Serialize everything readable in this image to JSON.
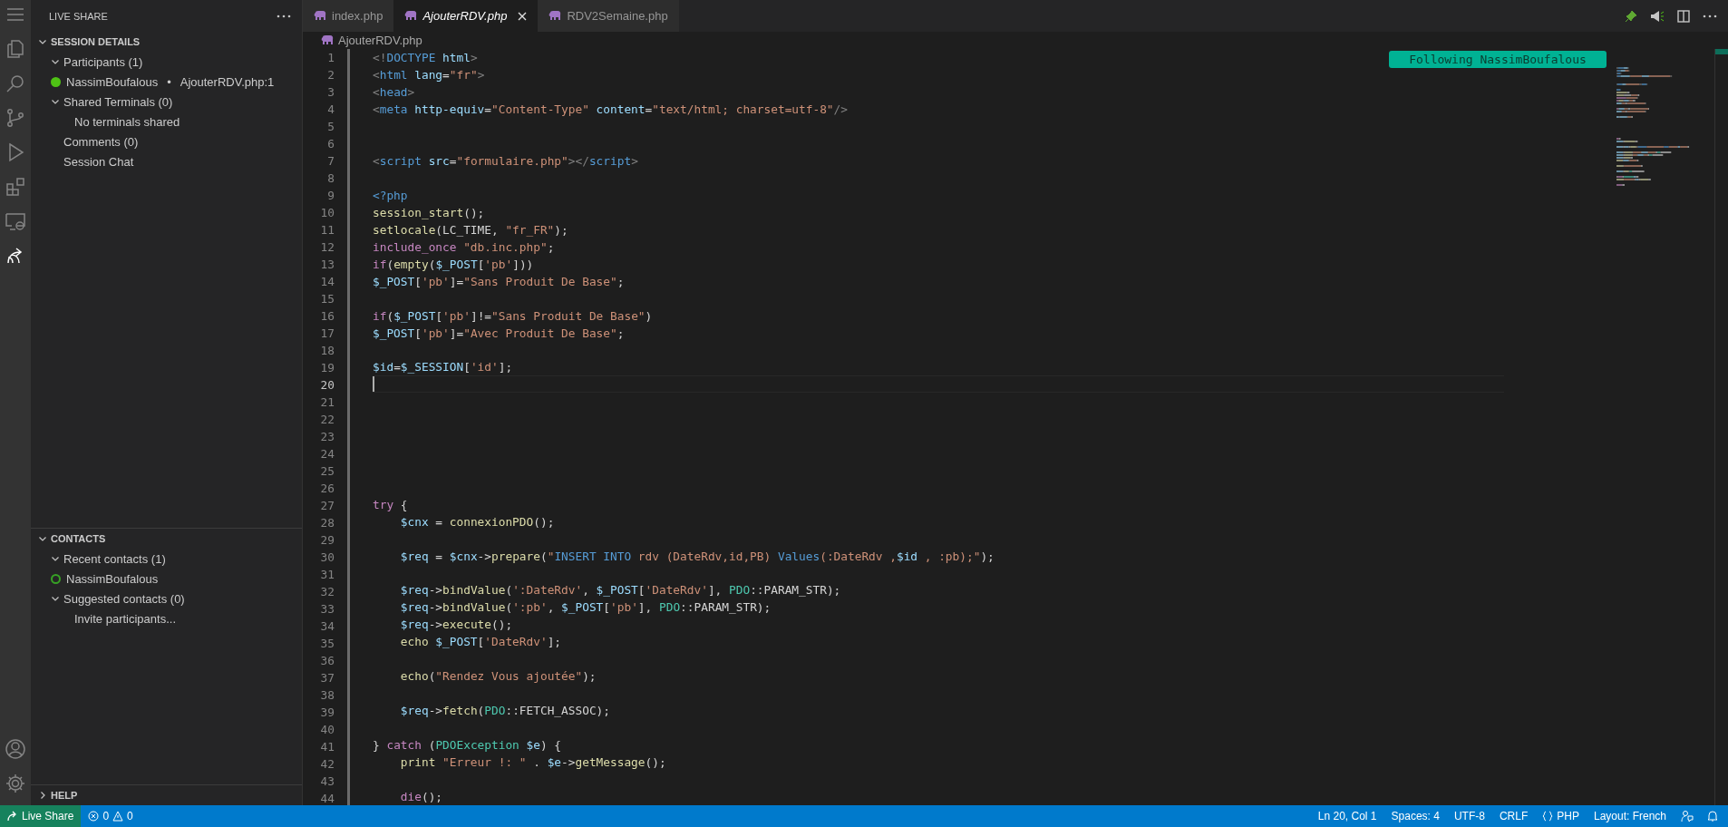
{
  "sidebar": {
    "title": "LIVE SHARE",
    "sections": [
      {
        "title": "SESSION DETAILS",
        "expanded": true,
        "items": [
          {
            "kind": "group",
            "label": "Participants (1)",
            "expanded": true,
            "children": [
              {
                "kind": "participant",
                "label": "NassimBoufalous",
                "separator": "•",
                "detail": "AjouterRDV.php:1"
              }
            ]
          },
          {
            "kind": "group",
            "label": "Shared Terminals (0)",
            "expanded": true,
            "children": [
              {
                "kind": "leaf",
                "label": "No terminals shared"
              }
            ]
          },
          {
            "kind": "leaf",
            "label": "Comments (0)"
          },
          {
            "kind": "leaf",
            "label": "Session Chat"
          }
        ]
      },
      {
        "title": "CONTACTS",
        "expanded": true,
        "items": [
          {
            "kind": "group",
            "label": "Recent contacts (1)",
            "expanded": true,
            "children": [
              {
                "kind": "contact",
                "label": "NassimBoufalous"
              }
            ]
          },
          {
            "kind": "group",
            "label": "Suggested contacts (0)",
            "expanded": true,
            "children": [
              {
                "kind": "leaf",
                "label": "Invite participants..."
              }
            ]
          }
        ]
      },
      {
        "title": "HELP",
        "expanded": false
      }
    ]
  },
  "tabs": [
    {
      "label": "index.php",
      "selected": false
    },
    {
      "label": "AjouterRDV.php",
      "selected": true
    },
    {
      "label": "RDV2Semaine.php",
      "selected": false
    }
  ],
  "breadcrumb": "AjouterRDV.php",
  "following_badge": "Following NassimBoufalous",
  "code_lines": [
    {
      "number": "1",
      "current": false,
      "tokens": [
        {
          "kind": "tag",
          "text": "<!"
        },
        {
          "kind": "tagname",
          "text": "DOCTYPE"
        },
        {
          "kind": "attr",
          "text": " html"
        },
        {
          "kind": "tag",
          "text": ">"
        }
      ]
    },
    {
      "number": "2",
      "current": false,
      "tokens": [
        {
          "kind": "tag",
          "text": "<"
        },
        {
          "kind": "tagname",
          "text": "html"
        },
        {
          "kind": "attr",
          "text": " lang"
        },
        {
          "kind": "plain",
          "text": "="
        },
        {
          "kind": "str",
          "text": "\"fr\""
        },
        {
          "kind": "tag",
          "text": ">"
        }
      ]
    },
    {
      "number": "3",
      "current": false,
      "tokens": [
        {
          "kind": "tag",
          "text": "<"
        },
        {
          "kind": "tagname",
          "text": "head"
        },
        {
          "kind": "tag",
          "text": ">"
        }
      ]
    },
    {
      "number": "4",
      "current": false,
      "tokens": [
        {
          "kind": "tag",
          "text": "<"
        },
        {
          "kind": "tagname",
          "text": "meta"
        },
        {
          "kind": "attr",
          "text": " http-equiv"
        },
        {
          "kind": "plain",
          "text": "="
        },
        {
          "kind": "str",
          "text": "\"Content-Type\""
        },
        {
          "kind": "attr",
          "text": " content"
        },
        {
          "kind": "plain",
          "text": "="
        },
        {
          "kind": "str",
          "text": "\"text/html; charset=utf-8\""
        },
        {
          "kind": "tag",
          "text": "/>"
        }
      ]
    },
    {
      "number": "5",
      "current": false
    },
    {
      "number": "6",
      "current": false
    },
    {
      "number": "7",
      "current": false,
      "tokens": [
        {
          "kind": "tag",
          "text": "<"
        },
        {
          "kind": "tagname",
          "text": "script"
        },
        {
          "kind": "attr",
          "text": " src"
        },
        {
          "kind": "plain",
          "text": "="
        },
        {
          "kind": "str",
          "text": "\"formulaire.php\""
        },
        {
          "kind": "tag",
          "text": "></"
        },
        {
          "kind": "tagname",
          "text": "script"
        },
        {
          "kind": "tag",
          "text": ">"
        }
      ]
    },
    {
      "number": "8",
      "current": false
    },
    {
      "number": "9",
      "current": false,
      "tokens": [
        {
          "kind": "tagname",
          "text": "<?php"
        }
      ]
    },
    {
      "number": "10",
      "current": false,
      "tokens": [
        {
          "kind": "fn",
          "text": "session_start"
        },
        {
          "kind": "plain",
          "text": "();"
        }
      ]
    },
    {
      "number": "11",
      "current": false,
      "tokens": [
        {
          "kind": "fn",
          "text": "setlocale"
        },
        {
          "kind": "plain",
          "text": "(LC_TIME,"
        },
        {
          "kind": "str",
          "text": " \"fr_FR\""
        },
        {
          "kind": "plain",
          "text": ");"
        }
      ]
    },
    {
      "number": "12",
      "current": false,
      "tokens": [
        {
          "kind": "kw",
          "text": "include_once"
        },
        {
          "kind": "str",
          "text": " \"db.inc.php\""
        },
        {
          "kind": "plain",
          "text": ";"
        }
      ]
    },
    {
      "number": "13",
      "current": false,
      "tokens": [
        {
          "kind": "kw",
          "text": "if"
        },
        {
          "kind": "plain",
          "text": "("
        },
        {
          "kind": "fn",
          "text": "empty"
        },
        {
          "kind": "plain",
          "text": "("
        },
        {
          "kind": "var",
          "text": "$_POST"
        },
        {
          "kind": "plain",
          "text": "["
        },
        {
          "kind": "str",
          "text": "'pb'"
        },
        {
          "kind": "plain",
          "text": "]))"
        }
      ]
    },
    {
      "number": "14",
      "current": false,
      "tokens": [
        {
          "kind": "var",
          "text": "$_POST"
        },
        {
          "kind": "plain",
          "text": "["
        },
        {
          "kind": "str",
          "text": "'pb'"
        },
        {
          "kind": "plain",
          "text": "]="
        },
        {
          "kind": "str",
          "text": "\"Sans Produit De Base\""
        },
        {
          "kind": "plain",
          "text": ";"
        }
      ]
    },
    {
      "number": "15",
      "current": false
    },
    {
      "number": "16",
      "current": false,
      "tokens": [
        {
          "kind": "kw",
          "text": "if"
        },
        {
          "kind": "plain",
          "text": "("
        },
        {
          "kind": "var",
          "text": "$_POST"
        },
        {
          "kind": "plain",
          "text": "["
        },
        {
          "kind": "str",
          "text": "'pb'"
        },
        {
          "kind": "plain",
          "text": "]!="
        },
        {
          "kind": "str",
          "text": "\"Sans Produit De Base\""
        },
        {
          "kind": "plain",
          "text": ")"
        }
      ]
    },
    {
      "number": "17",
      "current": false,
      "tokens": [
        {
          "kind": "var",
          "text": "$_POST"
        },
        {
          "kind": "plain",
          "text": "["
        },
        {
          "kind": "str",
          "text": "'pb'"
        },
        {
          "kind": "plain",
          "text": "]="
        },
        {
          "kind": "str",
          "text": "\"Avec Produit De Base\""
        },
        {
          "kind": "plain",
          "text": ";"
        }
      ]
    },
    {
      "number": "18",
      "current": false
    },
    {
      "number": "19",
      "current": false,
      "tokens": [
        {
          "kind": "var",
          "text": "$id"
        },
        {
          "kind": "plain",
          "text": "="
        },
        {
          "kind": "var",
          "text": "$_SESSION"
        },
        {
          "kind": "plain",
          "text": "["
        },
        {
          "kind": "str",
          "text": "'id'"
        },
        {
          "kind": "plain",
          "text": "];"
        }
      ]
    },
    {
      "number": "20",
      "current": true
    },
    {
      "number": "21",
      "current": false
    },
    {
      "number": "22",
      "current": false
    },
    {
      "number": "23",
      "current": false
    },
    {
      "number": "24",
      "current": false
    },
    {
      "number": "25",
      "current": false
    },
    {
      "number": "26",
      "current": false
    },
    {
      "number": "27",
      "current": false,
      "tokens": [
        {
          "kind": "kw",
          "text": "try"
        },
        {
          "kind": "plain",
          "text": " {"
        }
      ]
    },
    {
      "number": "28",
      "current": false,
      "tokens": [
        {
          "kind": "var",
          "text": "    $cnx"
        },
        {
          "kind": "plain",
          "text": " ="
        },
        {
          "kind": "fn",
          "text": " connexionPDO"
        },
        {
          "kind": "plain",
          "text": "();"
        }
      ]
    },
    {
      "number": "29",
      "current": false
    },
    {
      "number": "30",
      "current": false,
      "tokens": [
        {
          "kind": "var",
          "text": "    $req"
        },
        {
          "kind": "plain",
          "text": " ="
        },
        {
          "kind": "var",
          "text": " $cnx"
        },
        {
          "kind": "plain",
          "text": "->"
        },
        {
          "kind": "fn",
          "text": "prepare"
        },
        {
          "kind": "plain",
          "text": "("
        },
        {
          "kind": "str",
          "text": "\""
        },
        {
          "kind": "tagname",
          "text": "INSERT INTO"
        },
        {
          "kind": "str",
          "text": " rdv (DateRdv,id,PB) "
        },
        {
          "kind": "tagname",
          "text": "Values"
        },
        {
          "kind": "str",
          "text": "(:DateRdv ,"
        },
        {
          "kind": "var",
          "text": "$id"
        },
        {
          "kind": "str",
          "text": " , :pb);\""
        },
        {
          "kind": "plain",
          "text": ");"
        }
      ]
    },
    {
      "number": "31",
      "current": false
    },
    {
      "number": "32",
      "current": false,
      "tokens": [
        {
          "kind": "var",
          "text": "    $req"
        },
        {
          "kind": "plain",
          "text": "->"
        },
        {
          "kind": "fn",
          "text": "bindValue"
        },
        {
          "kind": "plain",
          "text": "("
        },
        {
          "kind": "str",
          "text": "':DateRdv'"
        },
        {
          "kind": "plain",
          "text": ","
        },
        {
          "kind": "var",
          "text": " $_POST"
        },
        {
          "kind": "plain",
          "text": "["
        },
        {
          "kind": "str",
          "text": "'DateRdv'"
        },
        {
          "kind": "plain",
          "text": "],"
        },
        {
          "kind": "cls",
          "text": " PDO"
        },
        {
          "kind": "plain",
          "text": "::PARAM_STR);"
        }
      ]
    },
    {
      "number": "33",
      "current": false,
      "tokens": [
        {
          "kind": "var",
          "text": "    $req"
        },
        {
          "kind": "plain",
          "text": "->"
        },
        {
          "kind": "fn",
          "text": "bindValue"
        },
        {
          "kind": "plain",
          "text": "("
        },
        {
          "kind": "str",
          "text": "':pb'"
        },
        {
          "kind": "plain",
          "text": ","
        },
        {
          "kind": "var",
          "text": " $_POST"
        },
        {
          "kind": "plain",
          "text": "["
        },
        {
          "kind": "str",
          "text": "'pb'"
        },
        {
          "kind": "plain",
          "text": "],"
        },
        {
          "kind": "cls",
          "text": " PDO"
        },
        {
          "kind": "plain",
          "text": "::PARAM_STR);"
        }
      ]
    },
    {
      "number": "34",
      "current": false,
      "tokens": [
        {
          "kind": "var",
          "text": "    $req"
        },
        {
          "kind": "plain",
          "text": "->"
        },
        {
          "kind": "fn",
          "text": "execute"
        },
        {
          "kind": "plain",
          "text": "();"
        }
      ]
    },
    {
      "number": "35",
      "current": false,
      "tokens": [
        {
          "kind": "fn",
          "text": "    echo"
        },
        {
          "kind": "var",
          "text": " $_POST"
        },
        {
          "kind": "plain",
          "text": "["
        },
        {
          "kind": "str",
          "text": "'DateRdv'"
        },
        {
          "kind": "plain",
          "text": "];"
        }
      ]
    },
    {
      "number": "36",
      "current": false
    },
    {
      "number": "37",
      "current": false,
      "tokens": [
        {
          "kind": "fn",
          "text": "    echo"
        },
        {
          "kind": "plain",
          "text": "("
        },
        {
          "kind": "str",
          "text": "\"Rendez Vous ajoutée\""
        },
        {
          "kind": "plain",
          "text": ");"
        }
      ]
    },
    {
      "number": "38",
      "current": false
    },
    {
      "number": "39",
      "current": false,
      "tokens": [
        {
          "kind": "var",
          "text": "    $req"
        },
        {
          "kind": "plain",
          "text": "->"
        },
        {
          "kind": "fn",
          "text": "fetch"
        },
        {
          "kind": "plain",
          "text": "("
        },
        {
          "kind": "cls",
          "text": "PDO"
        },
        {
          "kind": "plain",
          "text": "::FETCH_ASSOC);"
        }
      ]
    },
    {
      "number": "40",
      "current": false
    },
    {
      "number": "41",
      "current": false,
      "tokens": [
        {
          "kind": "plain",
          "text": "}"
        },
        {
          "kind": "kw",
          "text": " catch"
        },
        {
          "kind": "plain",
          "text": " ("
        },
        {
          "kind": "cls",
          "text": "PDOException"
        },
        {
          "kind": "var",
          "text": " $e"
        },
        {
          "kind": "plain",
          "text": ") {"
        }
      ]
    },
    {
      "number": "42",
      "current": false,
      "tokens": [
        {
          "kind": "fn",
          "text": "    print"
        },
        {
          "kind": "str",
          "text": " \"Erreur !: \""
        },
        {
          "kind": "plain",
          "text": " ."
        },
        {
          "kind": "var",
          "text": " $e"
        },
        {
          "kind": "plain",
          "text": "->"
        },
        {
          "kind": "fn",
          "text": "getMessage"
        },
        {
          "kind": "plain",
          "text": "();"
        }
      ]
    },
    {
      "number": "43",
      "current": false
    },
    {
      "number": "44",
      "current": false,
      "tokens": [
        {
          "kind": "kw",
          "text": "    die"
        },
        {
          "kind": "plain",
          "text": "();"
        }
      ]
    }
  ],
  "status_bar": {
    "live_share": "Live Share",
    "errors": "0",
    "warnings": "0",
    "right": [
      {
        "kind": "text",
        "label": "Ln 20, Col 1"
      },
      {
        "kind": "text",
        "label": "Spaces: 4"
      },
      {
        "kind": "text",
        "label": "UTF-8"
      },
      {
        "kind": "text",
        "label": "CRLF"
      },
      {
        "kind": "language",
        "label": "PHP"
      },
      {
        "kind": "text",
        "label": "Layout: French"
      }
    ]
  }
}
